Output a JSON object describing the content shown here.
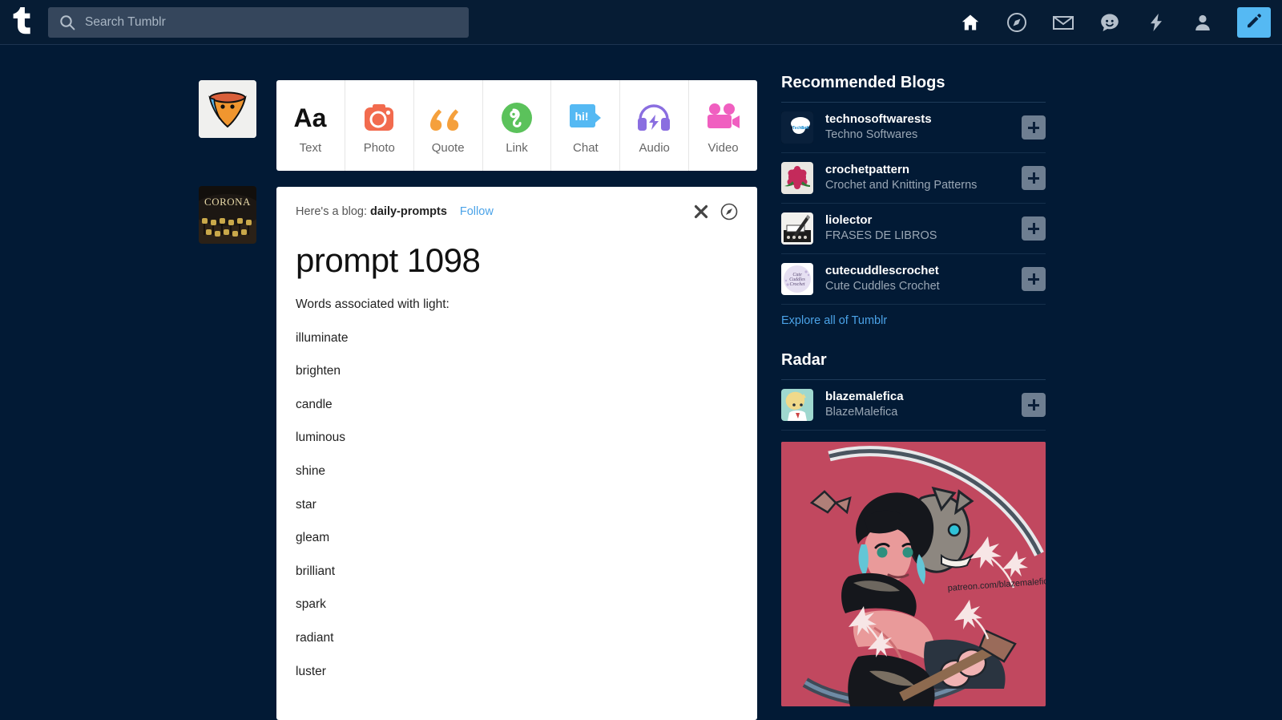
{
  "colors": {
    "page_bg": "#021a35",
    "topbar_bg": "#061c34",
    "search_bg": "#35465c",
    "accent_blue": "#55b9f3",
    "link_blue": "#4ba3e8",
    "card_white": "#ffffff",
    "plus_button": "#6e7e91",
    "radar_art_bg": "#c1485f"
  },
  "topbar": {
    "logo_icon": "tumblr-logo-icon",
    "search": {
      "icon": "search-icon",
      "placeholder": "Search Tumblr",
      "value": ""
    },
    "nav": [
      {
        "name": "home-icon",
        "label": "Home",
        "active": true
      },
      {
        "name": "compass-icon",
        "label": "Explore",
        "active": false
      },
      {
        "name": "mail-icon",
        "label": "Inbox",
        "active": false
      },
      {
        "name": "messaging-icon",
        "label": "Messages",
        "active": false
      },
      {
        "name": "activity-icon",
        "label": "Activity",
        "active": false
      },
      {
        "name": "account-icon",
        "label": "Account",
        "active": false
      }
    ],
    "compose": {
      "icon": "pencil-icon",
      "label": "Compose"
    }
  },
  "rail": {
    "user_avatar_alt": "user-avatar",
    "blog_avatar_alt": "daily-prompts-avatar"
  },
  "post_types": [
    {
      "label": "Text",
      "icon": "text-aa-icon",
      "color": "#111111"
    },
    {
      "label": "Photo",
      "icon": "camera-icon",
      "color": "#f26b4e"
    },
    {
      "label": "Quote",
      "icon": "quote-marks-icon",
      "color": "#f5a03c"
    },
    {
      "label": "Link",
      "icon": "link-chain-icon",
      "color": "#5bc25b"
    },
    {
      "label": "Chat",
      "icon": "chat-bubble-icon",
      "color": "#55b9f3"
    },
    {
      "label": "Audio",
      "icon": "headphones-icon",
      "color": "#8a6ee0"
    },
    {
      "label": "Video",
      "icon": "camcorder-icon",
      "color": "#f05fc0"
    }
  ],
  "chat_icon_text": "hi!",
  "post": {
    "header_lead": "Here's a blog:",
    "blog_name": "daily-prompts",
    "follow_label": "Follow",
    "dismiss_icon": "close-x-icon",
    "explore_icon": "compass-circle-icon",
    "title": "prompt 1098",
    "body": [
      "Words associated with light:",
      "illuminate",
      "brighten",
      "candle",
      "luminous",
      "shine",
      "star",
      "gleam",
      "brilliant",
      "spark",
      "radiant",
      "luster"
    ]
  },
  "sidebar": {
    "recommended_title": "Recommended Blogs",
    "recommended": [
      {
        "name": "technosoftwarests",
        "desc": "Techno Softwares",
        "follow": "+"
      },
      {
        "name": "crochetpattern",
        "desc": "Crochet and Knitting Patterns",
        "follow": "+"
      },
      {
        "name": "liolector",
        "desc": "FRASES DE LIBROS",
        "follow": "+"
      },
      {
        "name": "cutecuddlescrochet",
        "desc": "Cute Cuddles Crochet",
        "follow": "+"
      }
    ],
    "explore_all": "Explore all of Tumblr",
    "radar_title": "Radar",
    "radar": {
      "name": "blazemalefica",
      "desc": "BlazeMalefica",
      "follow": "+",
      "image_watermark": "patreon.com/blazemalefica"
    }
  }
}
